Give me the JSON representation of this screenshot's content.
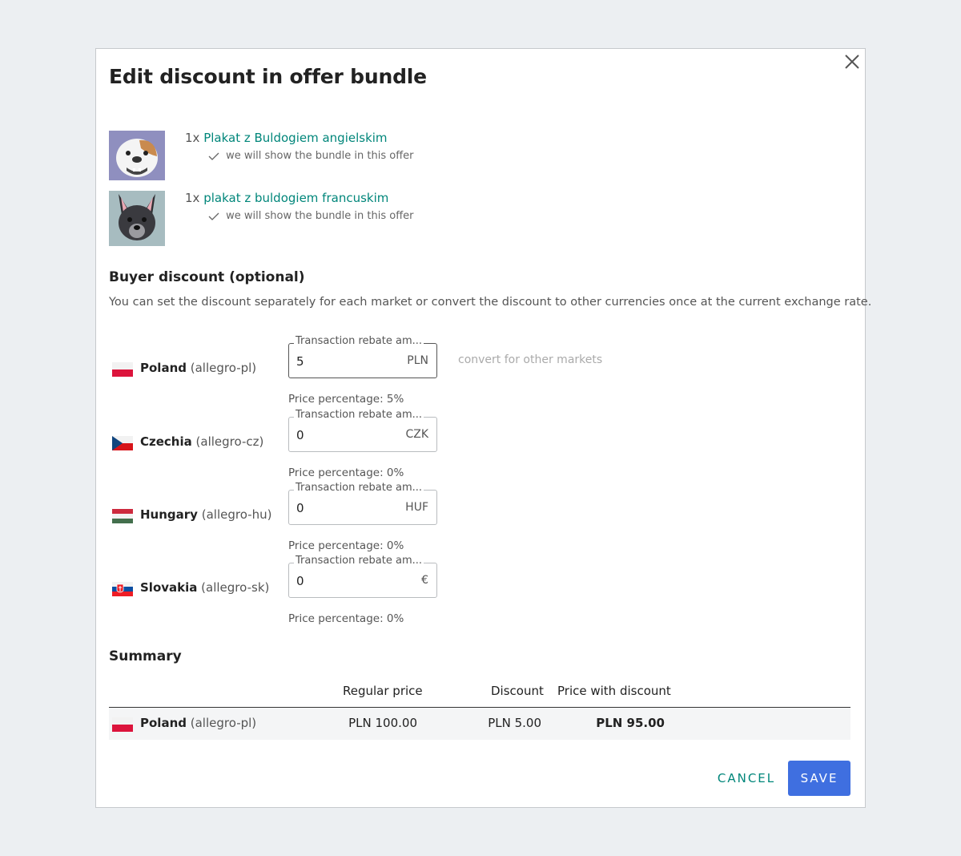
{
  "dialog": {
    "title": "Edit discount in offer bundle"
  },
  "offers": [
    {
      "qty": "1x",
      "name": "Plakat z Buldogiem angielskim",
      "note": "we will show the bundle in this offer"
    },
    {
      "qty": "1x",
      "name": "plakat z buldogiem francuskim",
      "note": "we will show the bundle in this offer"
    }
  ],
  "buyer_discount": {
    "heading": "Buyer discount (optional)",
    "description": "You can set the discount separately for each market or convert the discount to other currencies once at the current exchange rate.",
    "field_label": "Transaction rebate am...",
    "convert_label": "convert for other markets",
    "markets": [
      {
        "country": "Poland",
        "code": "(allegro-pl)",
        "value": "5",
        "currency": "PLN",
        "percentage": "Price percentage: 5%"
      },
      {
        "country": "Czechia",
        "code": "(allegro-cz)",
        "value": "0",
        "currency": "CZK",
        "percentage": "Price percentage: 0%"
      },
      {
        "country": "Hungary",
        "code": "(allegro-hu)",
        "value": "0",
        "currency": "HUF",
        "percentage": "Price percentage: 0%"
      },
      {
        "country": "Slovakia",
        "code": "(allegro-sk)",
        "value": "0",
        "currency": "€",
        "percentage": "Price percentage: 0%"
      }
    ]
  },
  "summary": {
    "heading": "Summary",
    "columns": {
      "regular": "Regular price",
      "discount": "Discount",
      "with_discount": "Price with discount"
    },
    "rows": [
      {
        "country": "Poland",
        "code": "(allegro-pl)",
        "regular": "PLN 100.00",
        "discount": "PLN 5.00",
        "with_discount": "PLN 95.00"
      }
    ]
  },
  "actions": {
    "cancel": "CANCEL",
    "save": "SAVE"
  },
  "colors": {
    "accent_link": "#00867a",
    "primary_button": "#3f6fe0"
  }
}
